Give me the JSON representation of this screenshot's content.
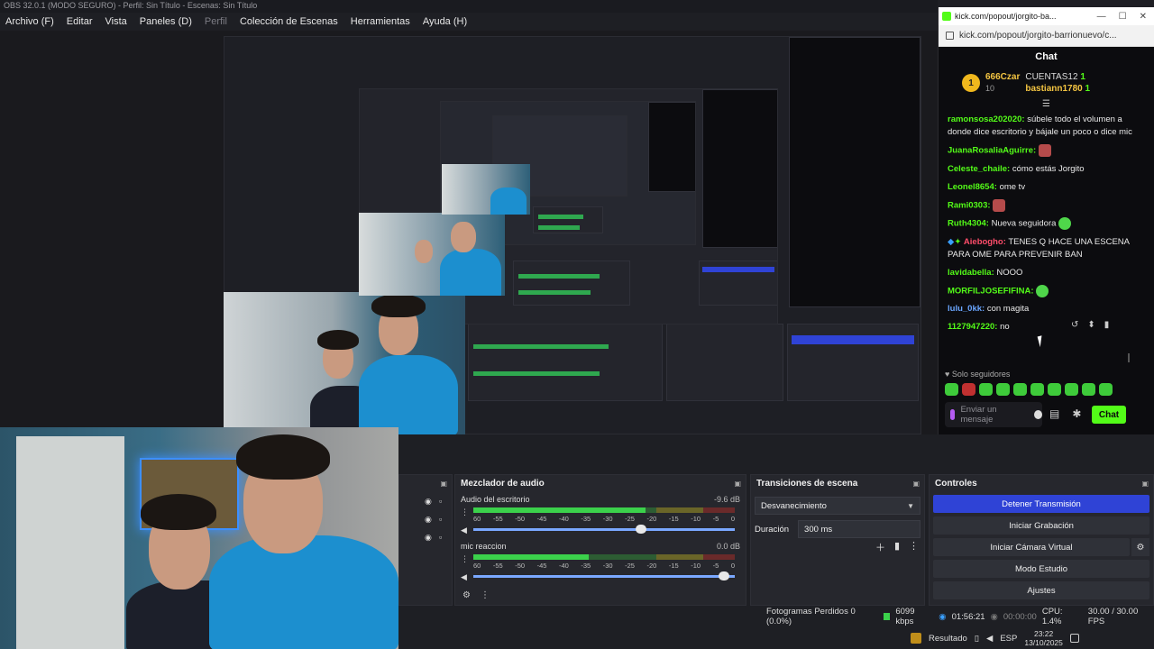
{
  "window": {
    "title": "OBS 32.0.1 (MODO SEGURO) - Perfil: Sin Título - Escenas: Sin Título"
  },
  "menu": {
    "items": [
      "Archivo (F)",
      "Editar",
      "Vista",
      "Paneles (D)",
      "Perfil",
      "Colección de Escenas",
      "Herramientas",
      "Ayuda (H)"
    ]
  },
  "chat_window": {
    "title": "kick.com/popout/jorgito-ba...",
    "url": "kick.com/popout/jorgito-barrionuevo/c...",
    "header": "Chat",
    "leaderboard": {
      "first_name": "666Czar",
      "first_count": "10",
      "second_name": "CUENTAS12",
      "second_count": "1",
      "third_name": "bastiann1780",
      "third_count": "1"
    },
    "messages": [
      {
        "user": "ramonsosa202020:",
        "color": "#53fc18",
        "text": "súbele todo el volumen a donde dice escritorio y bájale un poco o dice mic"
      },
      {
        "user": "JuanaRosaliaAguirre:",
        "color": "#53fc18",
        "text": ""
      },
      {
        "user": "Celeste_chaile:",
        "color": "#53fc18",
        "text": "cómo estás Jorgito"
      },
      {
        "user": "Leonel8654:",
        "color": "#53fc18",
        "text": "ome tv"
      },
      {
        "user": "Rami0303:",
        "color": "#53fc18",
        "text": ""
      },
      {
        "user": "Ruth4304:",
        "color": "#53fc18",
        "text": "Nueva seguidora"
      },
      {
        "user": "Aiebogho:",
        "color": "#ff4d6a",
        "text": "TENES Q HACE UNA ESCENA PARA OME PARA PREVENIR BAN"
      },
      {
        "user": "lavidabella:",
        "color": "#53fc18",
        "text": "NOOO"
      },
      {
        "user": "MORFILJOSEFIFINA:",
        "color": "#53fc18",
        "text": ""
      },
      {
        "user": "lulu_0kk:",
        "color": "#6aa6ff",
        "text": "con magita"
      },
      {
        "user": "1127947220:",
        "color": "#53fc18",
        "text": "no"
      }
    ],
    "followers_only": "Solo seguidores",
    "input_placeholder": "Enviar un mensaje",
    "send_label": "Chat"
  },
  "mixer": {
    "title": "Mezclador de audio",
    "channels": [
      {
        "name": "Audio del escritorio",
        "db": "-9.6 dB",
        "level": 0.66,
        "fader": 0.64
      },
      {
        "name": "mic reaccion",
        "db": "0.0 dB",
        "level": 0.44,
        "fader": 0.96
      }
    ],
    "scale": [
      "60",
      "-55",
      "-50",
      "-45",
      "-40",
      "-35",
      "-30",
      "-25",
      "-20",
      "-15",
      "-10",
      "-5",
      "0"
    ]
  },
  "transitions": {
    "title": "Transiciones de escena",
    "selected": "Desvanecimiento",
    "duration_label": "Duración",
    "duration_value": "300 ms"
  },
  "controls": {
    "title": "Controles",
    "stop_stream": "Detener Transmisión",
    "start_recording": "Iniciar Grabación",
    "start_virtual_cam": "Iniciar Cámara Virtual",
    "studio_mode": "Modo Estudio",
    "settings": "Ajustes"
  },
  "status": {
    "dropped_frames": "Fotogramas Perdidos 0 (0.0%)",
    "bitrate": "6099 kbps",
    "live_time": "01:56:21",
    "rec_time": "00:00:00",
    "cpu": "CPU: 1.4%",
    "fps": "30.00 / 30.00 FPS"
  },
  "taskbar": {
    "app": "Resultado",
    "lang": "ESP",
    "time": "23:22",
    "date": "13/10/2025"
  },
  "colors": {
    "kick_green": "#53fc18",
    "obs_blue": "#2f43d6"
  }
}
